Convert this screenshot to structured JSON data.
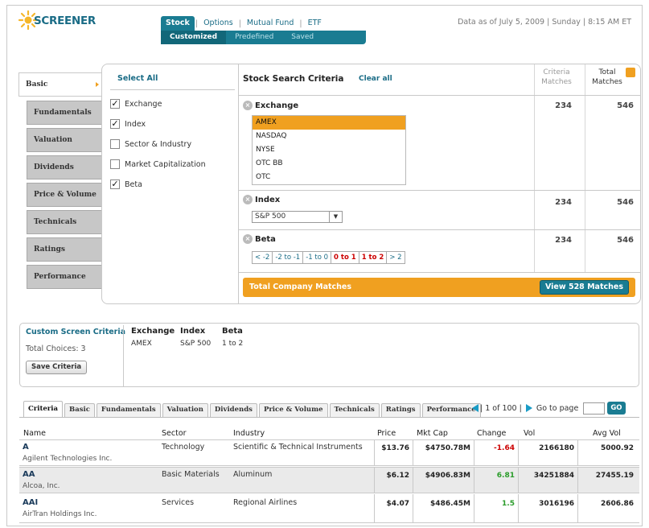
{
  "header": {
    "logo_text": "SCREENER",
    "nav_tabs": [
      {
        "label": "Stock",
        "active": true
      },
      {
        "label": "Options",
        "active": false
      },
      {
        "label": "Mutual Fund",
        "active": false
      },
      {
        "label": "ETF",
        "active": false
      }
    ],
    "subnav": [
      {
        "label": "Customized",
        "active": true
      },
      {
        "label": "Predefined",
        "active": false
      },
      {
        "label": "Saved",
        "active": false
      }
    ],
    "as_of": "Data as of July 5, 2009 | Sunday | 8:15 AM ET"
  },
  "leftnav": [
    {
      "label": "Basic",
      "active": true
    },
    {
      "label": "Fundamentals",
      "active": false
    },
    {
      "label": "Valuation",
      "active": false
    },
    {
      "label": "Dividends",
      "active": false
    },
    {
      "label": "Price & Volume",
      "active": false
    },
    {
      "label": "Technicals",
      "active": false
    },
    {
      "label": "Ratings",
      "active": false
    },
    {
      "label": "Performance",
      "active": false
    }
  ],
  "select": {
    "select_all": "Select All",
    "items": [
      {
        "label": "Exchange",
        "checked": true
      },
      {
        "label": "Index",
        "checked": true
      },
      {
        "label": "Sector & Industry",
        "checked": false
      },
      {
        "label": "Market Capitalization",
        "checked": false
      },
      {
        "label": "Beta",
        "checked": true
      }
    ]
  },
  "criteria": {
    "title": "Stock Search Criteria",
    "clear_all": "Clear all",
    "col_matches": "Criteria Matches",
    "col_total": "Total Matches",
    "exchange": {
      "label": "Exchange",
      "matches": "234",
      "total": "546",
      "options": [
        "AMEX",
        "NASDAQ",
        "NYSE",
        "OTC BB",
        "OTC"
      ],
      "selected": "AMEX"
    },
    "index": {
      "label": "Index",
      "matches": "234",
      "total": "546",
      "selected": "S&P 500"
    },
    "beta": {
      "label": "Beta",
      "matches": "234",
      "total": "546",
      "buttons": [
        {
          "label": "< -2",
          "selected": false
        },
        {
          "label": "-2 to -1",
          "selected": false
        },
        {
          "label": "-1 to 0",
          "selected": false
        },
        {
          "label": "0 to 1",
          "selected": true
        },
        {
          "label": "1 to 2",
          "selected": true
        },
        {
          "label": "> 2",
          "selected": false
        }
      ]
    },
    "total_label": "Total Company Matches",
    "view_button": "View 528 Matches"
  },
  "custom": {
    "title": "Custom Screen Criteria",
    "total_choices": "Total Choices: 3",
    "save_button": "Save Criteria",
    "columns": [
      {
        "header": "Exchange",
        "value": "AMEX"
      },
      {
        "header": "Index",
        "value": "S&P 500"
      },
      {
        "header": "Beta",
        "value": "1 to 2"
      }
    ]
  },
  "results": {
    "tabs": [
      "Criteria",
      "Basic",
      "Fundamentals",
      "Valuation",
      "Dividends",
      "Price & Volume",
      "Technicals",
      "Ratings",
      "Performance"
    ],
    "active_tab": "Criteria",
    "pager_text": "| 1 of 100 |",
    "goto_label": "Go to page",
    "go_button": "GO",
    "columns": [
      "Name",
      "Sector",
      "Industry",
      "Price",
      "Mkt Cap",
      "Change",
      "Vol",
      "Avg Vol"
    ],
    "rows": [
      {
        "ticker": "A",
        "name": "Agilent Technologies Inc.",
        "sector": "Technology",
        "industry": "Scientific & Technical Instruments",
        "price": "$13.76",
        "mktcap": "$4750.78M",
        "change": "-1.64",
        "vol": "2166180",
        "avgvol": "5000.92"
      },
      {
        "ticker": "AA",
        "name": "Alcoa, Inc.",
        "sector": "Basic Materials",
        "industry": "Aluminum",
        "price": "$6.12",
        "mktcap": "$4906.83M",
        "change": "6.81",
        "vol": "34251884",
        "avgvol": "27455.19"
      },
      {
        "ticker": "AAI",
        "name": "AirTran Holdings Inc.",
        "sector": "Services",
        "industry": "Regional Airlines",
        "price": "$4.07",
        "mktcap": "$486.45M",
        "change": "1.5",
        "vol": "3016196",
        "avgvol": "2606.86"
      }
    ]
  },
  "colors": {
    "teal": "#1a7c92",
    "orange": "#f0a020",
    "link": "#1a6c86"
  }
}
